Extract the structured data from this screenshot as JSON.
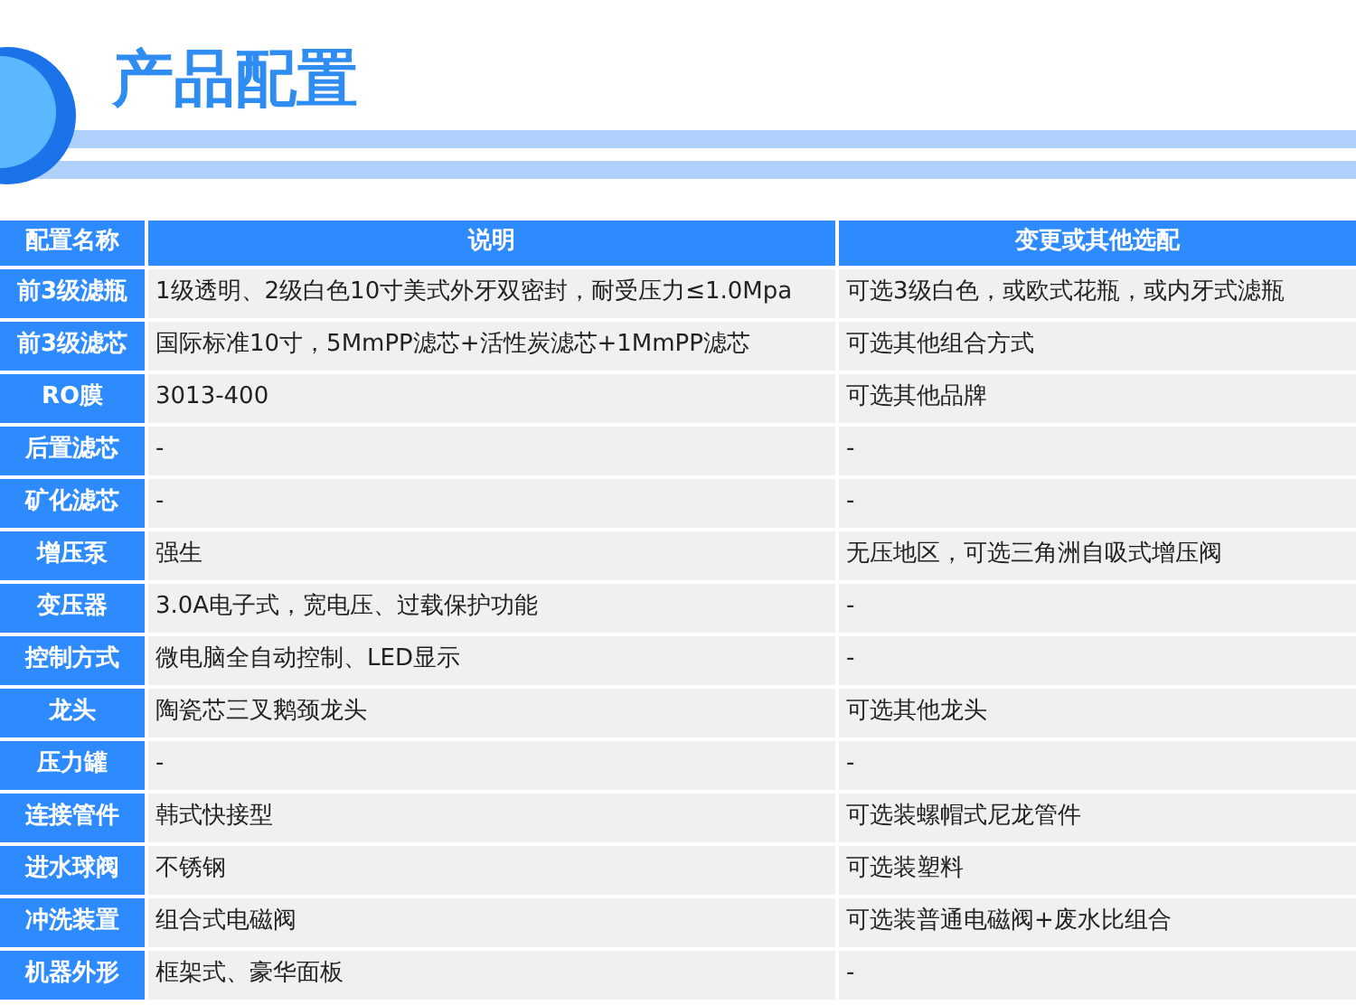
{
  "heading": {
    "title": "产品配置"
  },
  "table": {
    "columns": [
      "配置名称",
      "说明",
      "变更或其他选配"
    ],
    "rows": [
      [
        "前3级滤瓶",
        "1级透明、2级白色10寸美式外牙双密封，耐受压力≤1.0Mpa",
        "可选3级白色，或欧式花瓶，或内牙式滤瓶"
      ],
      [
        "前3级滤芯",
        "国际标准10寸，5MmPP滤芯+活性炭滤芯+1MmPP滤芯",
        "可选其他组合方式"
      ],
      [
        "RO膜",
        "3013-400",
        "可选其他品牌"
      ],
      [
        "后置滤芯",
        "-",
        "-"
      ],
      [
        "矿化滤芯",
        "-",
        "-"
      ],
      [
        "增压泵",
        "强生",
        "无压地区，可选三角洲自吸式增压阀"
      ],
      [
        "变压器",
        "3.0A电子式，宽电压、过载保护功能",
        "-"
      ],
      [
        "控制方式",
        "微电脑全自动控制、LED显示",
        "-"
      ],
      [
        "龙头",
        "陶瓷芯三叉鹅颈龙头",
        "可选其他龙头"
      ],
      [
        "压力罐",
        "-",
        "-"
      ],
      [
        "连接管件",
        "韩式快接型",
        "可选装螺帽式尼龙管件"
      ],
      [
        "进水球阀",
        "不锈钢",
        "可选装塑料"
      ],
      [
        "冲洗装置",
        "组合式电磁阀",
        "可选装普通电磁阀+废水比组合"
      ],
      [
        "机器外形",
        "框架式、豪华面板",
        "-"
      ]
    ]
  }
}
